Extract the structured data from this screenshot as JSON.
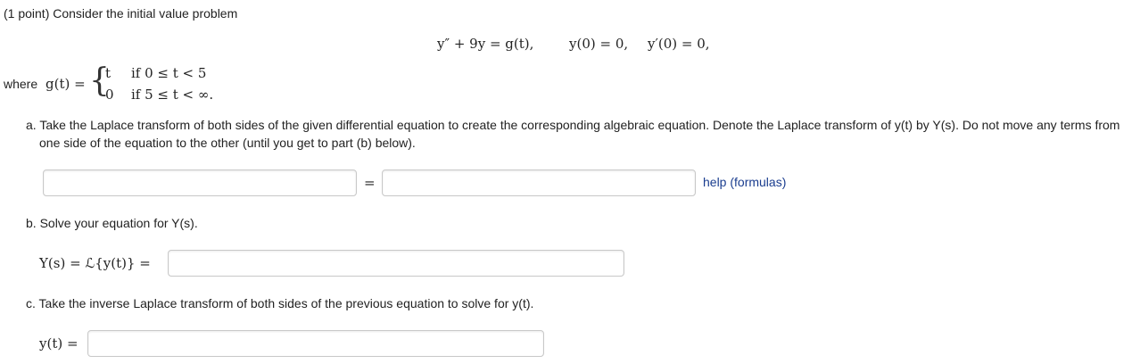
{
  "problem": {
    "intro": "(1 point) Consider the initial value problem",
    "ode": "y″ + 9y = g(t),",
    "ic1": "y(0) = 0,",
    "ic2": "y′(0) = 0,",
    "where_label": "where",
    "g_def": "g(t) =",
    "case1_expr": "t",
    "case1_cond": "if 0 ≤ t < 5",
    "case2_expr": "0",
    "case2_cond": "if 5 ≤ t < ∞."
  },
  "part_a": {
    "text_line1": "a. Take the Laplace transform of both sides of the given differential equation to create the corresponding algebraic equation. Denote the Laplace transform of y(t) by Y(s). Do not move any terms from",
    "text_line2": "one side of the equation to the other (until you get to part (b) below).",
    "left_value": "",
    "equals": "=",
    "right_value": "",
    "help_link": "help (formulas)"
  },
  "part_b": {
    "text": "b. Solve your equation for Y(s).",
    "label": "Y(s) = ℒ{y(t)} =",
    "value": ""
  },
  "part_c": {
    "text": "c. Take the inverse Laplace transform of both sides of the previous equation to solve for y(t).",
    "label": "y(t) =",
    "value": ""
  }
}
